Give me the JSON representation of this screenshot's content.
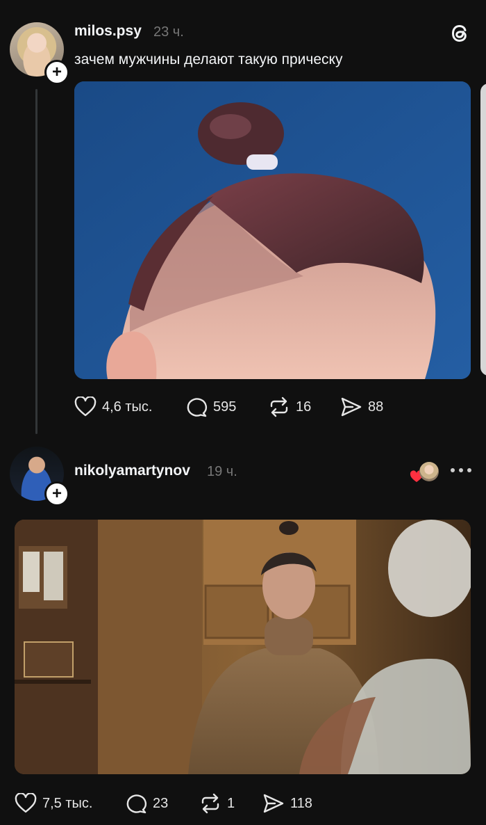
{
  "posts": [
    {
      "username": "milos.psy",
      "time": "23 ч.",
      "caption": "зачем мужчины делают такую прическу",
      "actions": {
        "likes": "4,6 тыс.",
        "comments": "595",
        "reposts": "16",
        "shares": "88"
      }
    },
    {
      "username": "nikolyamartynov",
      "time": "19 ч.",
      "actions": {
        "likes": "7,5 тыс.",
        "comments": "23",
        "reposts": "1",
        "shares": "118"
      }
    }
  ],
  "icons": {
    "logo": "threads-logo-icon",
    "like": "heart-icon",
    "comment": "comment-bubble-icon",
    "repost": "repost-icon",
    "share": "send-icon",
    "follow": "plus-icon",
    "menu": "more-dots-icon"
  },
  "colors": {
    "background": "#101010",
    "text": "#f3f5f7",
    "muted": "#777777",
    "liked_heart": "#ff3040"
  }
}
